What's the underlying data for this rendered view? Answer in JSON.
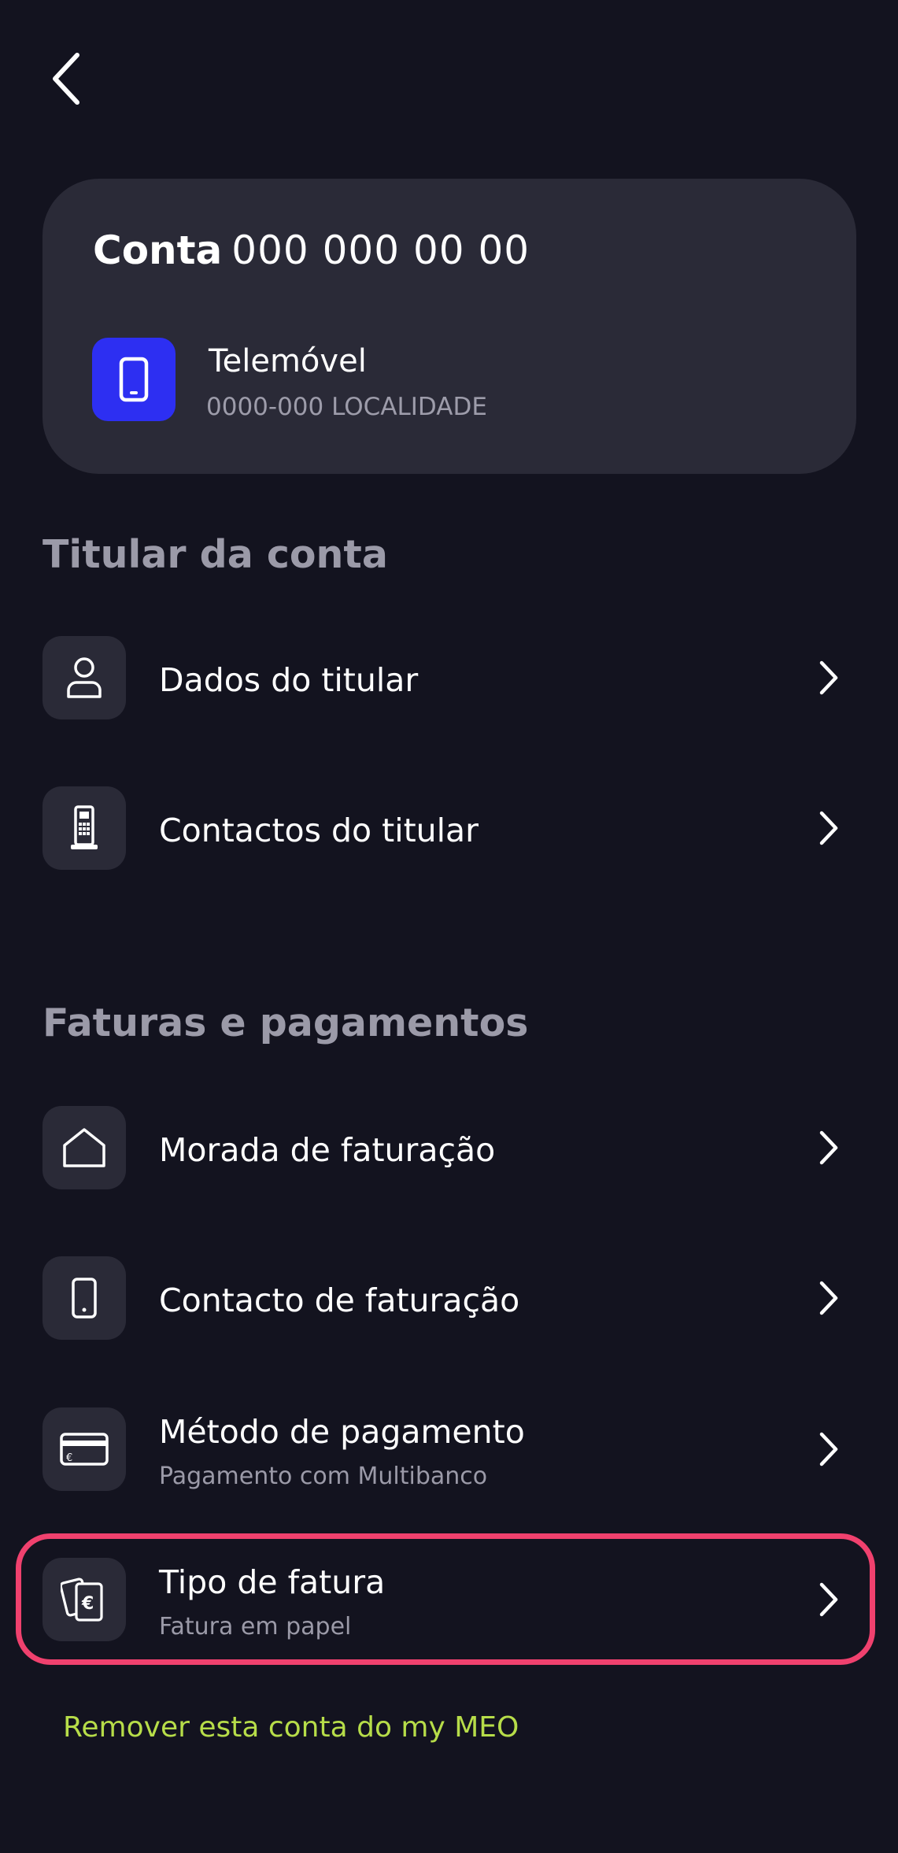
{
  "nav": {
    "back_icon": "chevron-left-icon"
  },
  "account": {
    "label": "Conta",
    "number": "000 000 00 00",
    "service_icon": "mobile-phone-icon",
    "service_name": "Telemóvel",
    "location": "0000-000 LOCALIDADE",
    "badge_color": "#2d2ff2"
  },
  "sections": [
    {
      "title": "Titular da conta",
      "items": [
        {
          "label": "Dados do titular",
          "icon": "person-icon"
        },
        {
          "label": "Contactos do titular",
          "icon": "landline-phone-icon"
        }
      ]
    },
    {
      "title": "Faturas e pagamentos",
      "items": [
        {
          "label": "Morada de faturação",
          "icon": "house-icon"
        },
        {
          "label": "Contacto de faturação",
          "icon": "mobile-phone-icon"
        },
        {
          "label": "Método de pagamento",
          "sub": "Pagamento com Multibanco",
          "icon": "credit-card-icon"
        },
        {
          "label": "Tipo de fatura",
          "sub": "Fatura em papel",
          "icon": "invoice-euro-icon",
          "highlighted": true
        }
      ]
    }
  ],
  "remove_link": "Remover esta conta do my MEO",
  "colors": {
    "background": "#13131f",
    "card": "#2a2a37",
    "highlight": "#f0416e",
    "link": "#b7dd49",
    "muted_text": "#9b9aa8"
  }
}
